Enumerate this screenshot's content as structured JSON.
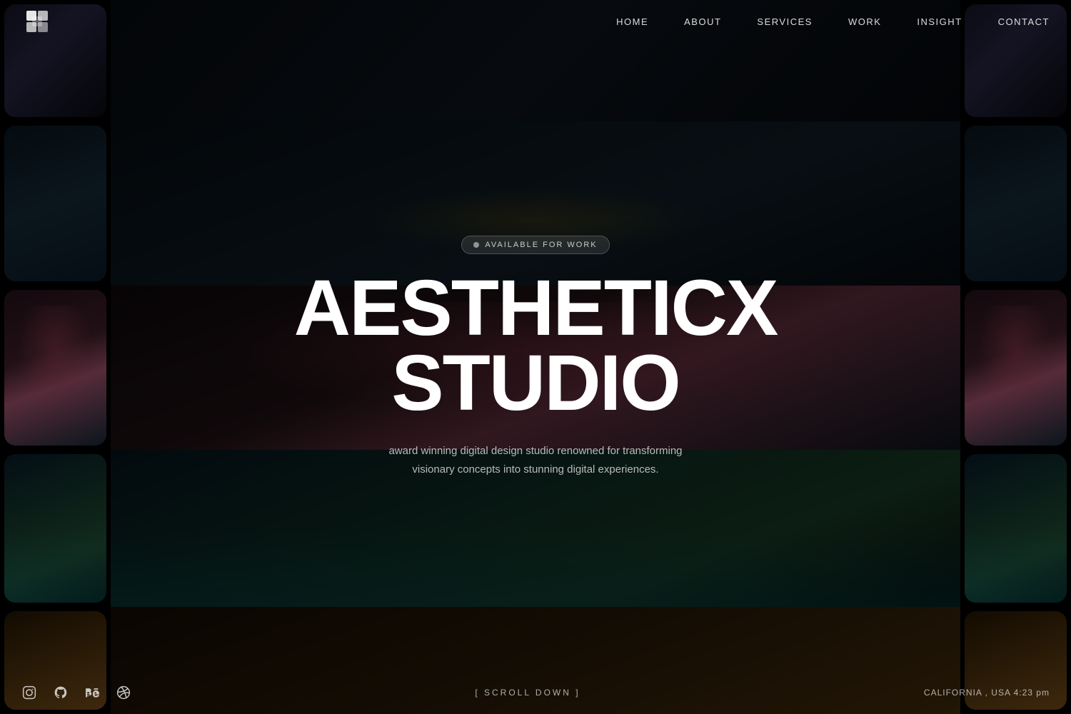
{
  "header": {
    "logo_alt": "AestheticX Logo",
    "nav": {
      "home": "HOME",
      "about": "ABOUT",
      "services": "SERVICES",
      "work": "WORK",
      "insight": "INSIGHT",
      "contact": "CONTACT"
    }
  },
  "hero": {
    "badge": "AVAILABLE FOR WORK",
    "title_line1": "AESTHETICX",
    "title_line2": "STUDIO",
    "subtitle": "award winning digital design studio renowned for transforming visionary concepts into stunning digital experiences."
  },
  "footer": {
    "scroll_cta": "[ SCROLL DOWN ]",
    "location": "CALIFORNIA , USA 4:23 pm",
    "social": {
      "instagram": "Instagram",
      "github": "GitHub",
      "behance": "Behance",
      "dribbble": "Dribbble"
    }
  }
}
